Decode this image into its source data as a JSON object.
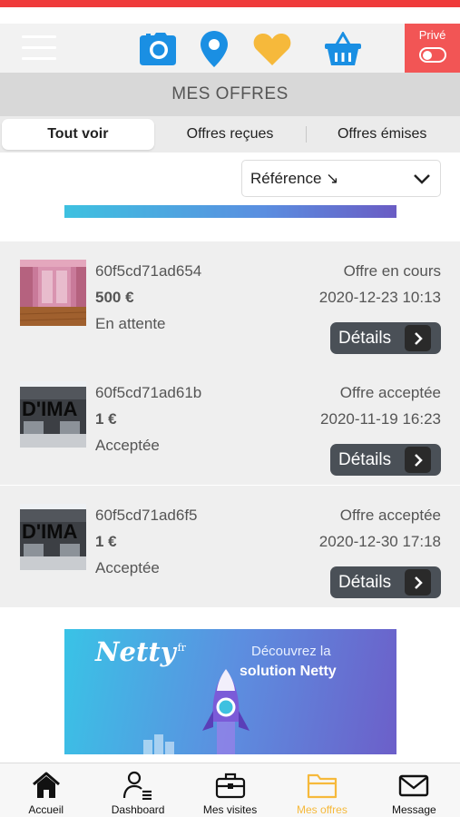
{
  "topbar": {
    "icons": [
      "camera-icon",
      "map-pin-icon",
      "heart-icon",
      "basket-icon"
    ],
    "prive_label": "Privé"
  },
  "page_title": "MES OFFRES",
  "tabs": [
    {
      "label": "Tout voir",
      "active": true
    },
    {
      "label": "Offres reçues",
      "active": false
    },
    {
      "label": "Offres émises",
      "active": false
    }
  ],
  "sort": {
    "selected": "Référence ↘"
  },
  "offers": [
    {
      "reference": "60f5cd71ad654",
      "price": "500 €",
      "state": "En attente",
      "status": "Offre en cours",
      "date": "2020-12-23 10:13",
      "details_label": "Détails",
      "thumb": "pink-room-photo"
    },
    {
      "reference": "60f5cd71ad61b",
      "price": "1 €",
      "state": "Acceptée",
      "status": "Offre acceptée",
      "date": "2020-11-19 16:23",
      "details_label": "Détails",
      "thumb": "storefront-dima-photo"
    },
    {
      "reference": "60f5cd71ad6f5",
      "price": "1 €",
      "state": "Acceptée",
      "status": "Offre acceptée",
      "date": "2020-12-30 17:18",
      "details_label": "Détails",
      "thumb": "storefront-dima-photo"
    }
  ],
  "thumb_sign_text": "D'IMA",
  "banner": {
    "logo": "Netty",
    "logo_sup": "fr",
    "line1": "Découvrez la",
    "line2": "solution Netty"
  },
  "bottom_nav": [
    {
      "label": "Accueil",
      "icon": "home-icon",
      "active": false
    },
    {
      "label": "Dashboard",
      "icon": "user-list-icon",
      "active": false
    },
    {
      "label": "Mes visites",
      "icon": "briefcase-icon",
      "active": false
    },
    {
      "label": "Mes offres",
      "icon": "folder-icon",
      "active": true
    },
    {
      "label": "Message",
      "icon": "envelope-icon",
      "active": false
    }
  ],
  "colors": {
    "accent_red": "#ef3b3b",
    "camera_blue": "#1a8fe3",
    "heart_orange": "#f6b93b",
    "active_nav": "#f6b93b"
  }
}
